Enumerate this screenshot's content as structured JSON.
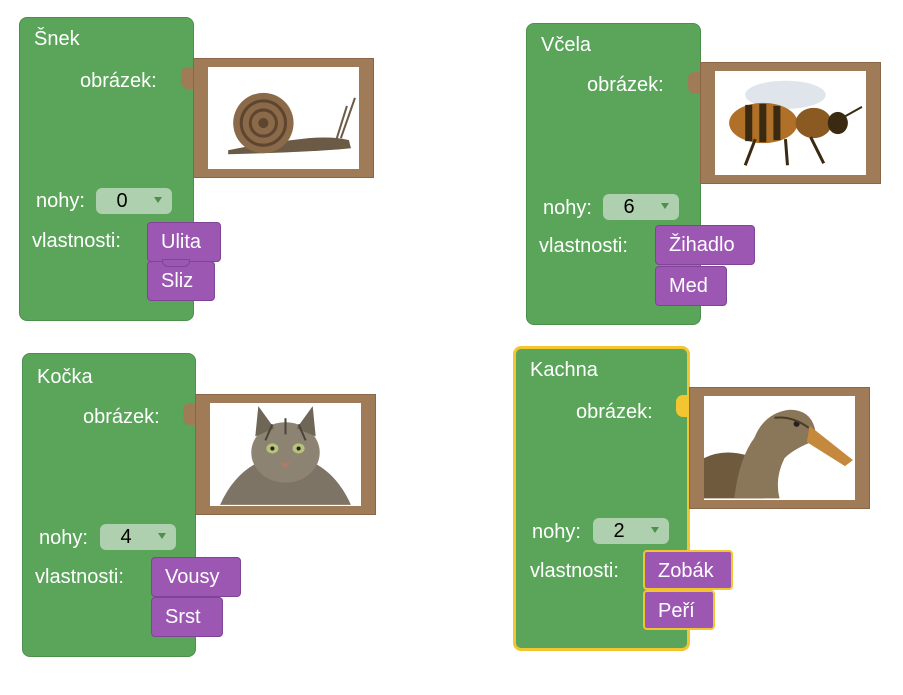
{
  "blocks": [
    {
      "title": "Šnek",
      "image_label": "obrázek:",
      "image_subject": "snail",
      "legs_label": "nohy:",
      "legs_value": "0",
      "props_label": "vlastnosti:",
      "props": [
        "Ulita",
        "Sliz"
      ]
    },
    {
      "title": "Včela",
      "image_label": "obrázek:",
      "image_subject": "bee",
      "legs_label": "nohy:",
      "legs_value": "6",
      "props_label": "vlastnosti:",
      "props": [
        "Žihadlo",
        "Med"
      ]
    },
    {
      "title": "Kočka",
      "image_label": "obrázek:",
      "image_subject": "cat",
      "legs_label": "nohy:",
      "legs_value": "4",
      "props_label": "vlastnosti:",
      "props": [
        "Vousy",
        "Srst"
      ]
    },
    {
      "title": "Kachna",
      "image_label": "obrázek:",
      "image_subject": "duck",
      "legs_label": "nohy:",
      "legs_value": "2",
      "props_label": "vlastnosti:",
      "props": [
        "Zobák",
        "Peří"
      ]
    }
  ],
  "colors": {
    "block_green": "#5ba55b",
    "property_purple": "#9c57b3",
    "image_frame_brown": "#a07b58",
    "selection_yellow": "#f3c530"
  },
  "icons": [
    "dropdown-arrow-icon"
  ]
}
